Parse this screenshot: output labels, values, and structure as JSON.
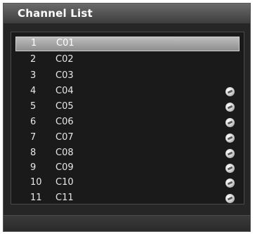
{
  "window": {
    "title": "Channel List"
  },
  "channels": [
    {
      "number": "1",
      "name": "C01",
      "selected": true,
      "has_icon": false
    },
    {
      "number": "2",
      "name": "C02",
      "selected": false,
      "has_icon": false
    },
    {
      "number": "3",
      "name": "C03",
      "selected": false,
      "has_icon": false
    },
    {
      "number": "4",
      "name": "C04",
      "selected": false,
      "has_icon": true
    },
    {
      "number": "5",
      "name": "C05",
      "selected": false,
      "has_icon": true
    },
    {
      "number": "6",
      "name": "C06",
      "selected": false,
      "has_icon": true
    },
    {
      "number": "7",
      "name": "C07",
      "selected": false,
      "has_icon": true
    },
    {
      "number": "8",
      "name": "C08",
      "selected": false,
      "has_icon": true
    },
    {
      "number": "9",
      "name": "C09",
      "selected": false,
      "has_icon": true
    },
    {
      "number": "10",
      "name": "C10",
      "selected": false,
      "has_icon": true
    },
    {
      "number": "11",
      "name": "C11",
      "selected": false,
      "has_icon": true
    }
  ],
  "icons": {
    "channel_status": "channel-status-icon"
  },
  "colors": {
    "background": "#262626",
    "panel": "#1a1a1a",
    "selection": "#a8a8a8",
    "text": "#e8e8e8"
  }
}
